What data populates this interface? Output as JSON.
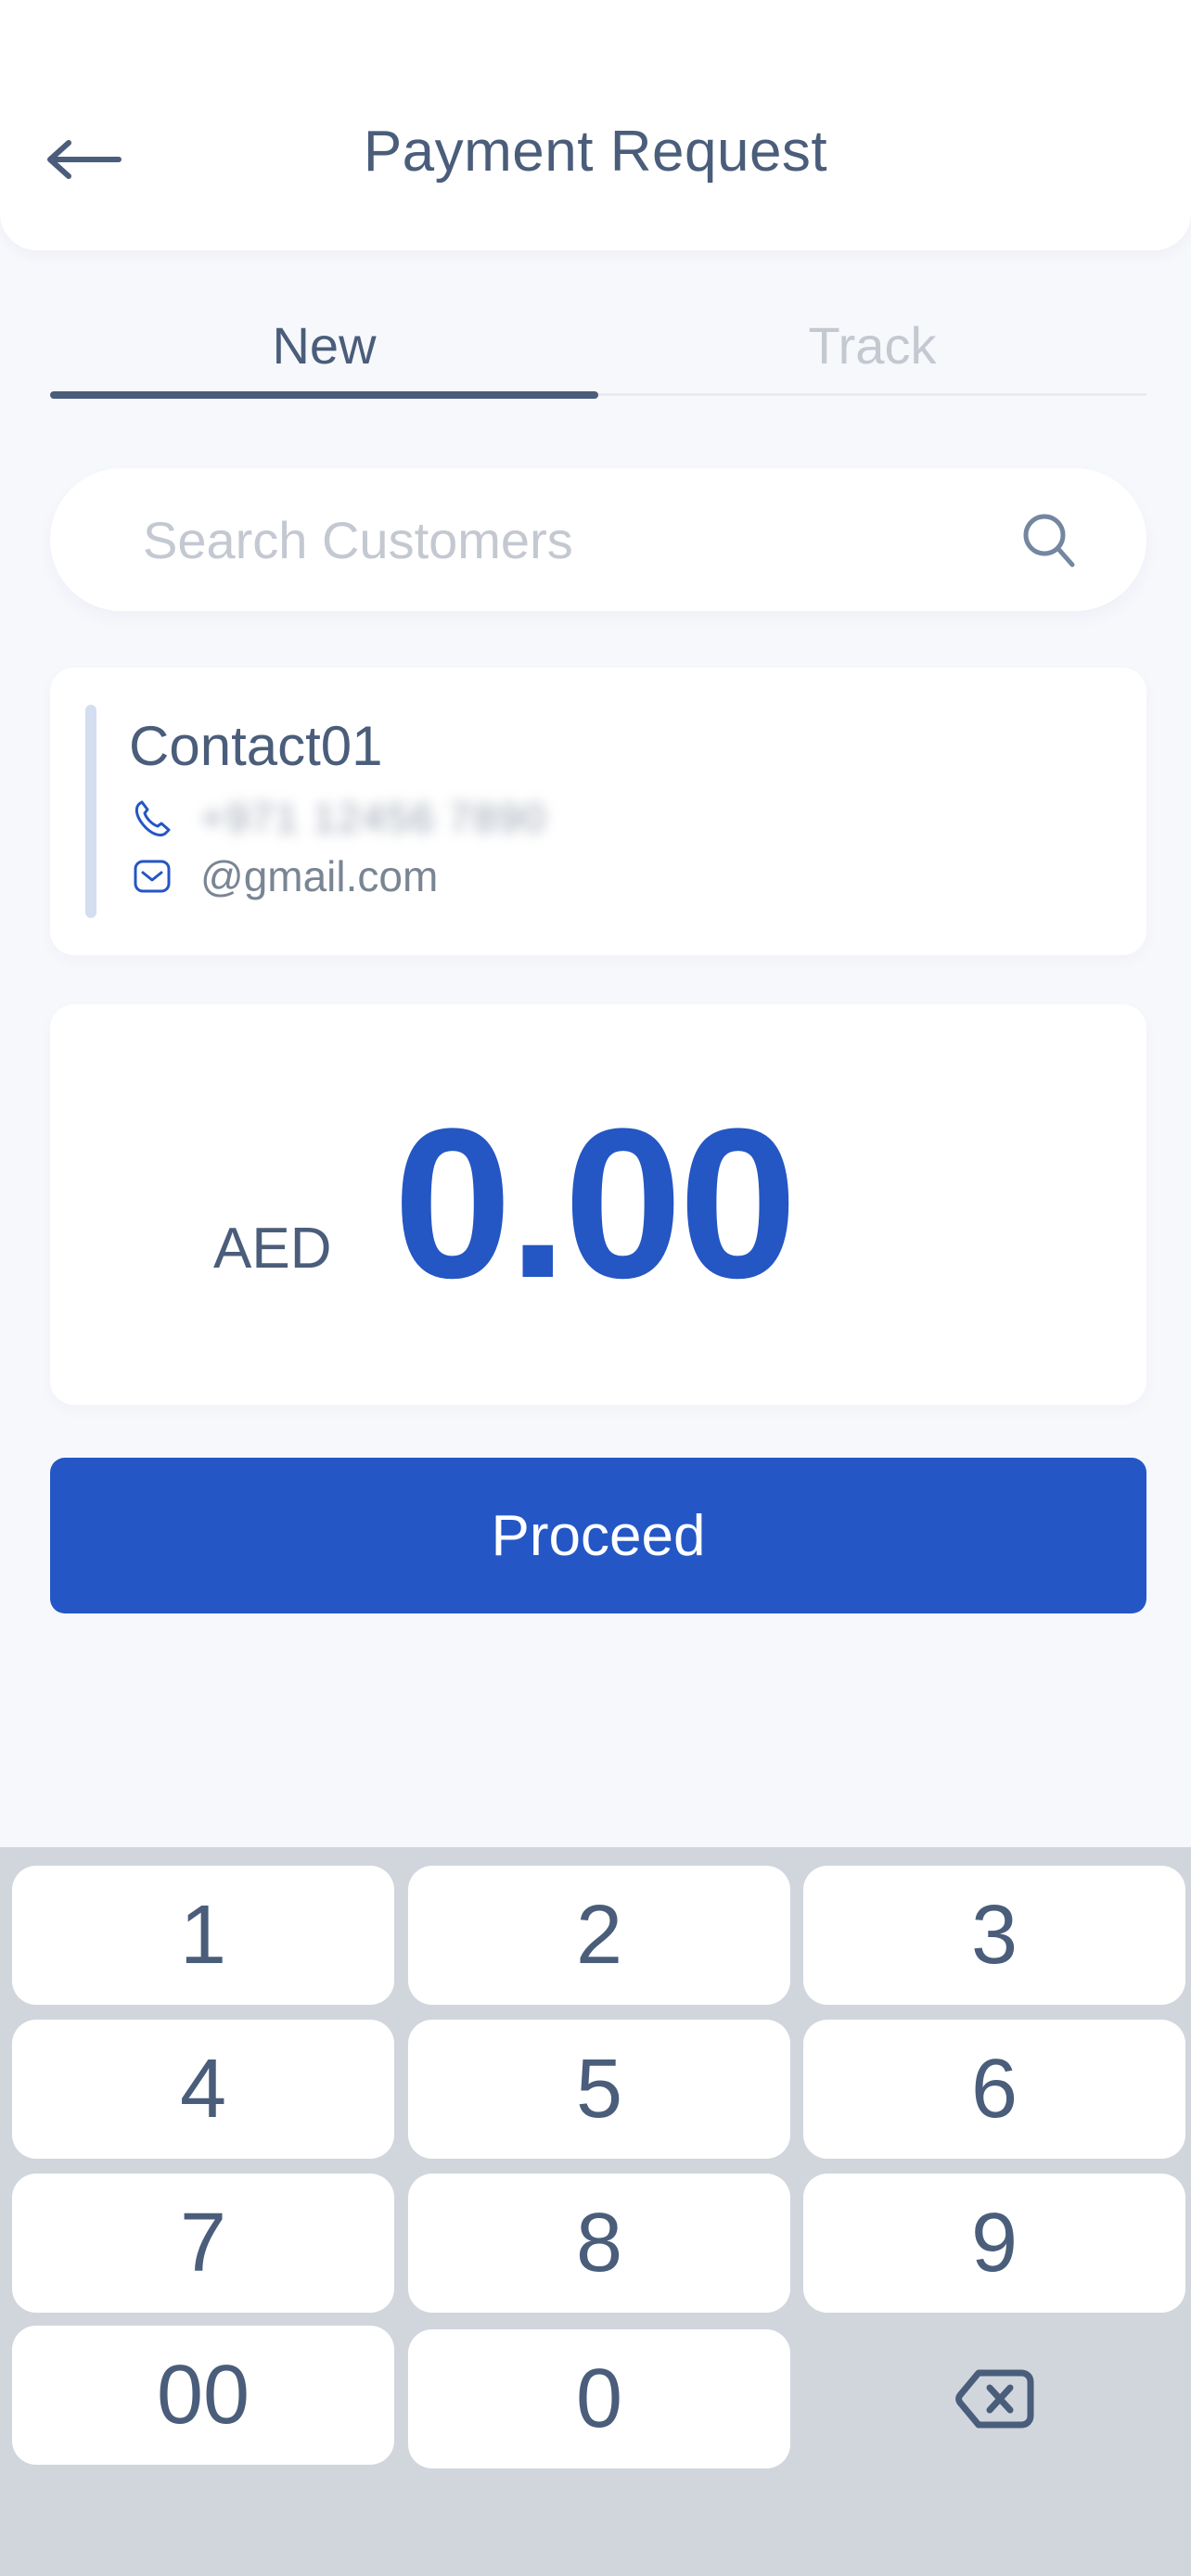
{
  "header": {
    "title": "Payment Request",
    "back_icon": "arrow-left-icon"
  },
  "tabs": [
    {
      "label": "New",
      "active": true
    },
    {
      "label": "Track",
      "active": false
    }
  ],
  "search": {
    "placeholder": "Search Customers",
    "value": "",
    "icon": "search-icon"
  },
  "contact": {
    "name": "Contact01",
    "phone": "+971 12456 7890",
    "phone_redacted": true,
    "email": "@gmail.com"
  },
  "amount": {
    "currency": "AED",
    "value": "0.00"
  },
  "proceed_label": "Proceed",
  "keypad": {
    "keys": [
      "1",
      "2",
      "3",
      "4",
      "5",
      "6",
      "7",
      "8",
      "9",
      "00",
      "0"
    ],
    "backspace_icon": "backspace-icon"
  },
  "colors": {
    "primary": "#2457c5",
    "text": "#4a5d7a",
    "muted": "#c3c8d1",
    "background": "#f7f8fc",
    "keypad_bg": "#d1d6dd"
  }
}
